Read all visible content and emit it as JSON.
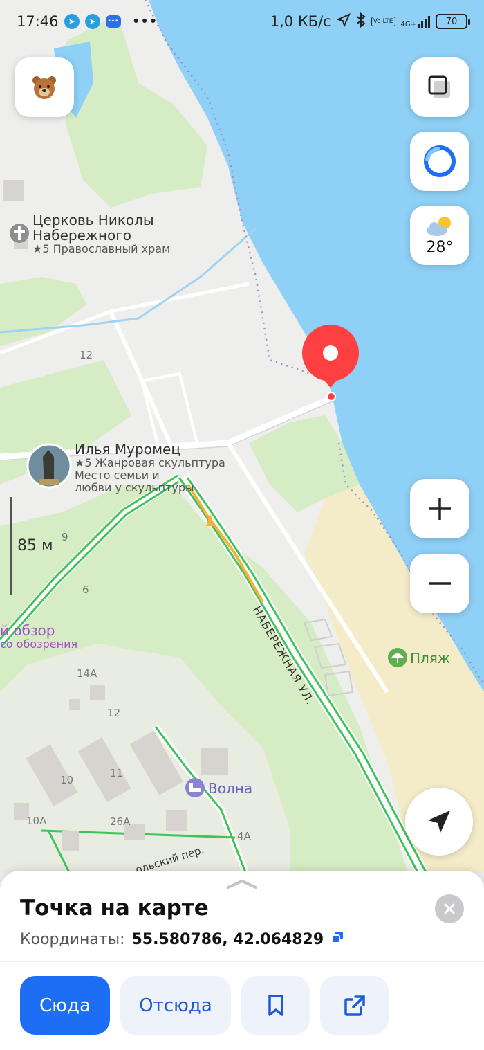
{
  "status_bar": {
    "time": "17:46",
    "notification_icons": [
      "telegram-icon",
      "telegram-icon",
      "chat-icon"
    ],
    "more": "•••",
    "speed": "1,0 КБ/с",
    "volte": "Vo LTE",
    "network": "4G+",
    "battery": "70"
  },
  "map": {
    "scale_label": "85 м",
    "weather_temp": "28°",
    "pois": {
      "church_name_line1": "Церковь Николы",
      "church_name_line2": "Набережного",
      "church_sub": "★5 Православный храм",
      "statue_name": "Илья Муромец",
      "statue_sub1": "★5 Жанровая скульптура",
      "statue_sub2": "Место семьи и",
      "statue_sub3": "любви у скульптуры",
      "view_line1": "й обзор",
      "view_line2": "со обозрения",
      "beach": "Пляж",
      "hotel": "Волна"
    },
    "street_embankment": "НАБЕРЕЖНАЯ УЛ.",
    "street_lane": "ольский пер.",
    "houses": [
      "12",
      "9",
      "6",
      "14А",
      "12",
      "10",
      "11",
      "10А",
      "26А",
      "4А"
    ]
  },
  "sheet": {
    "title": "Точка на карте",
    "coords_label": "Координаты:",
    "coords_value": "55.580786, 42.064829",
    "btn_to": "Сюда",
    "btn_from": "Отсюда"
  },
  "colors": {
    "water": "#8fd0f6",
    "park": "#d6ecc4",
    "beach": "#f4ecc9",
    "road_green": "#3fc45a",
    "road_orange": "#f4b23a",
    "pin": "#ff4040",
    "primary": "#1e6ef5"
  }
}
